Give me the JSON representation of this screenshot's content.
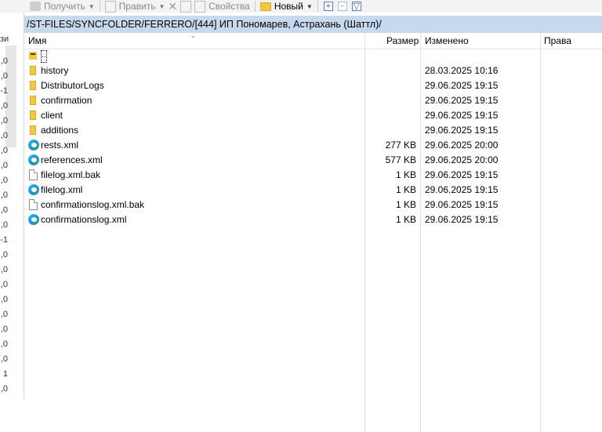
{
  "toolbar": {
    "receive_label": "Получить",
    "edit_label": "Править",
    "properties_label": "Свойства",
    "new_label": "Новый"
  },
  "path": "/ST-FILES/SYNCFOLDER/FERRERO/[444] ИП Пономарев, Астрахань (Шаттл)/",
  "columns": {
    "name": "Имя",
    "size": "Размер",
    "modified": "Изменено",
    "rights": "Права"
  },
  "left_pane": {
    "header": "зи",
    "rows": [
      ",0",
      ",0",
      "-1",
      ",0",
      ",0",
      ",0",
      ",0",
      ",0",
      ",0",
      ",0",
      ",0",
      ",0",
      "-1",
      ",0",
      ",0",
      ",0",
      ",0",
      ",0",
      ",0",
      ",0",
      ",0",
      "1",
      ",0",
      ",0",
      ",0"
    ]
  },
  "files": [
    {
      "name": "..",
      "size": "",
      "modified": "",
      "icon": "parent-dir-icon"
    },
    {
      "name": "history",
      "size": "",
      "modified": "28.03.2025 10:16",
      "icon": "folder-icon"
    },
    {
      "name": "DistributorLogs",
      "size": "",
      "modified": "29.06.2025 19:15",
      "icon": "folder-icon"
    },
    {
      "name": "confirmation",
      "size": "",
      "modified": "29.06.2025 19:15",
      "icon": "folder-icon"
    },
    {
      "name": "client",
      "size": "",
      "modified": "29.06.2025 19:15",
      "icon": "folder-icon"
    },
    {
      "name": "additions",
      "size": "",
      "modified": "29.06.2025 19:15",
      "icon": "folder-icon"
    },
    {
      "name": "rests.xml",
      "size": "277 KB",
      "modified": "29.06.2025 20:00",
      "icon": "edge-xml-icon"
    },
    {
      "name": "references.xml",
      "size": "577 KB",
      "modified": "29.06.2025 20:00",
      "icon": "edge-xml-icon"
    },
    {
      "name": "filelog.xml.bak",
      "size": "1 KB",
      "modified": "29.06.2025 19:15",
      "icon": "file-icon"
    },
    {
      "name": "filelog.xml",
      "size": "1 KB",
      "modified": "29.06.2025 19:15",
      "icon": "edge-xml-icon"
    },
    {
      "name": "confirmationslog.xml.bak",
      "size": "1 KB",
      "modified": "29.06.2025 19:15",
      "icon": "file-icon"
    },
    {
      "name": "confirmationslog.xml",
      "size": "1 KB",
      "modified": "29.06.2025 19:15",
      "icon": "edge-xml-icon"
    }
  ]
}
